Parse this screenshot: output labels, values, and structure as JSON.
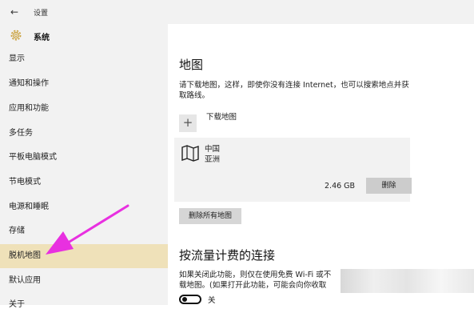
{
  "window": {
    "title": "设置"
  },
  "sidebar": {
    "header": "系统",
    "items": [
      {
        "label": "显示"
      },
      {
        "label": "通知和操作"
      },
      {
        "label": "应用和功能"
      },
      {
        "label": "多任务"
      },
      {
        "label": "平板电脑模式"
      },
      {
        "label": "节电模式"
      },
      {
        "label": "电源和睡眠"
      },
      {
        "label": "存储"
      },
      {
        "label": "脱机地图",
        "selected": true
      },
      {
        "label": "默认应用"
      },
      {
        "label": "关于"
      }
    ]
  },
  "maps": {
    "heading": "地图",
    "description": "请下载地图，这样，即使你没有连接 Internet，也可以搜索地点并获取路线。",
    "download_label": "下载地图",
    "region": {
      "country": "中国",
      "continent": "亚洲",
      "size": "2.46 GB",
      "delete_label": "删除"
    },
    "delete_all_label": "删除所有地图"
  },
  "metered": {
    "heading": "按流量计费的连接",
    "line1": "如果关闭此功能，则仅在使用免费 Wi-Fi 或不",
    "line2": "载地图。(如果打开此功能，可能会向你收取",
    "toggle_label": "关",
    "toggle_on": false
  },
  "colors": {
    "selected_bg": "#efe1b9",
    "arrow": "#e830e0"
  }
}
